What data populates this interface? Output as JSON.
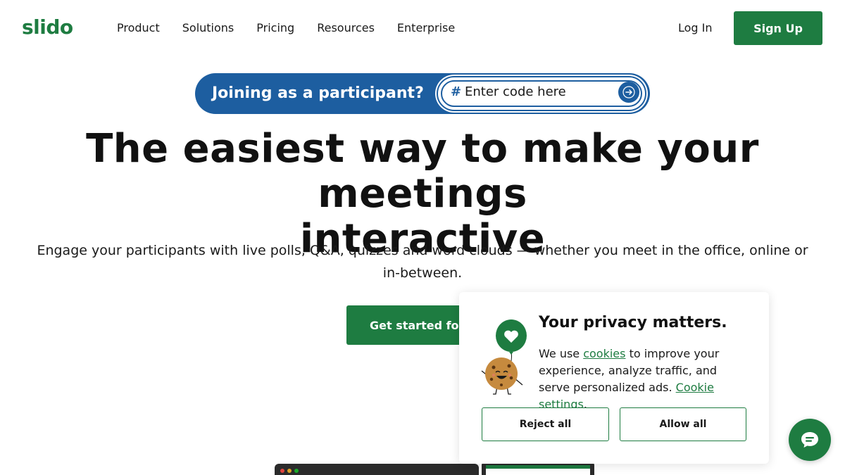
{
  "header": {
    "logo": "slido",
    "nav": [
      "Product",
      "Solutions",
      "Pricing",
      "Resources",
      "Enterprise"
    ],
    "login_label": "Log In",
    "signup_label": "Sign Up"
  },
  "participant_bar": {
    "label": "Joining as a participant?",
    "hash_symbol": "#",
    "input_placeholder": "Enter code here",
    "submit_icon": "arrow-right-icon"
  },
  "hero": {
    "title_line1": "The easiest way to make your meetings",
    "title_line2": "interactive",
    "subtitle": "Engage your participants with live polls, Q&A, quizzes and word clouds — whether you meet in the office, online or in-between.",
    "cta_label": "Get started for free"
  },
  "cookie_banner": {
    "title": "Your privacy matters.",
    "text_1": "We use ",
    "link_cookies": "cookies",
    "text_2": " to improve your experience, analyze traffic, and serve personalized ads. ",
    "link_settings": "Cookie settings",
    "text_3": ".",
    "reject_label": "Reject all",
    "allow_label": "Allow all",
    "art_icon": "cookie-with-heart-balloon-icon"
  },
  "chat": {
    "icon": "chat-bubble-icon"
  },
  "colors": {
    "brand_green": "#1e7c41",
    "participant_blue": "#1d5ea0",
    "text": "#1a1a1a"
  }
}
